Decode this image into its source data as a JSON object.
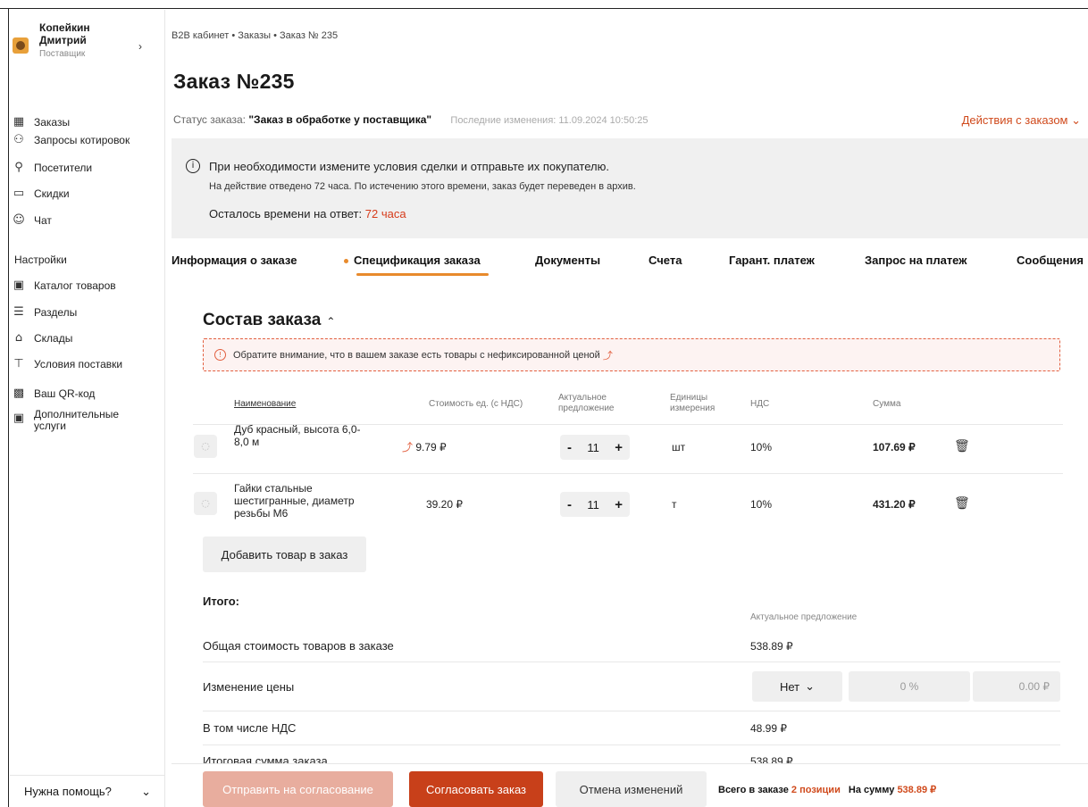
{
  "user": {
    "name_line1": "Копейкин",
    "name_line2": "Дмитрий",
    "role": "Поставщик",
    "arrow": "›"
  },
  "nav": {
    "items": [
      {
        "label": "Заказы",
        "icon": "orders-icon",
        "glyph": "▦"
      },
      {
        "label": "Запросы котировок",
        "icon": "quotes-icon",
        "glyph": "⚇"
      },
      {
        "label": "Посетители",
        "icon": "visitors-icon",
        "glyph": "⚲"
      },
      {
        "label": "Скидки",
        "icon": "discounts-icon",
        "glyph": "▭"
      },
      {
        "label": "Чат",
        "icon": "chat-icon",
        "glyph": "☺"
      }
    ],
    "settings_title": "Настройки",
    "settings_items": [
      {
        "label": "Каталог товаров",
        "icon": "catalog-icon",
        "glyph": "▣"
      },
      {
        "label": "Разделы",
        "icon": "sections-icon",
        "glyph": "☰"
      },
      {
        "label": "Склады",
        "icon": "warehouse-icon",
        "glyph": "⌂"
      },
      {
        "label": "Условия поставки",
        "icon": "delivery-icon",
        "glyph": "⊤"
      },
      {
        "label": "Ваш QR-код",
        "icon": "qr-icon",
        "glyph": "▩"
      },
      {
        "label": "Дополнительные услуги",
        "icon": "services-icon",
        "glyph": "▣"
      }
    ],
    "help": "Нужна помощь?",
    "help_arrow": "⌄"
  },
  "breadcrumb": {
    "text": "B2B кабинет • Заказы • Заказ № 235"
  },
  "order": {
    "title": "Заказ №235",
    "status_label": "Статус заказа:",
    "status_value": "\"Заказ в обработке у поставщика\"",
    "last_changed": "Последние изменения: 11.09.2024 10:50:25",
    "actions": "Действия с заказом ⌄"
  },
  "notice": {
    "info": "i",
    "line1": "При необходимости измените условия сделки и отправьте их покупателю.",
    "line2": "На действие отведено 72 часа. По истечению этого времени, заказ будет переведен в архив.",
    "line3_label": "Осталось времени на ответ:",
    "line3_value": "72 часа"
  },
  "tabs": [
    "Информация о заказе",
    "Спецификация заказа",
    "Документы",
    "Счета",
    "Гарант. платеж",
    "Запрос на платеж",
    "Сообщения"
  ],
  "composition": {
    "title": "Состав заказа",
    "chevron": "⌃",
    "warning": "Обратите внимание, что в вашем заказе есть товары с нефиксированной ценой",
    "warning_icon": "!",
    "chart_glyph": "⤴"
  },
  "table": {
    "headers": {
      "name": "Наименование",
      "price": "Стоимость ед. (с НДС)",
      "actual1": "Актуальное",
      "actual2": "предложение",
      "units1": "Единицы",
      "units2": "измерения",
      "vat": "НДС",
      "sum": "Сумма"
    },
    "rows": [
      {
        "name1": "Дуб красный, высота 6,0-",
        "name2": "8,0 м",
        "name3": "",
        "price": "9.79 ₽",
        "qty": "11",
        "unit": "шт",
        "vat": "10%",
        "sum": "107.69 ₽",
        "price_chart": "⤴"
      },
      {
        "name1": "Гайки стальные",
        "name2": "шестигранные, диаметр",
        "name3": "резьбы М6",
        "price": "39.20 ₽",
        "qty": "11",
        "unit": "т",
        "vat": "10%",
        "sum": "431.20 ₽",
        "price_chart": ""
      }
    ],
    "minus": "-",
    "plus": "+",
    "trash": "🗑",
    "prod_glyph": "◌"
  },
  "add_button": "Добавить товар в заказ",
  "totals": {
    "title": "Итого:",
    "actual_label": "Актуальное предложение",
    "goods_label": "Общая стоимость товаров в заказе",
    "goods_value": "538.89 ₽",
    "change_label": "Изменение цены",
    "change_select": "Нет",
    "change_select_arrow": "⌄",
    "change_pct": "0 %",
    "change_amount": "0.00 ₽",
    "vat_label": "В том числе НДС",
    "vat_value": "48.99 ₽",
    "final_label": "Итоговая сумма заказа",
    "final_value": "538.89 ₽"
  },
  "footer": {
    "send": "Отправить на согласование",
    "agree": "Согласовать заказ",
    "cancel": "Отмена изменений",
    "summary_label": "Всего в заказе",
    "positions": "2 позиции",
    "sum_label": "На сумму",
    "sum_value": "538.89 ₽"
  },
  "colors": {
    "accent": "#d04a1c",
    "tab_accent": "#e88a2c",
    "agree_button": "#c8401a",
    "send_button": "#e8ad9e"
  }
}
